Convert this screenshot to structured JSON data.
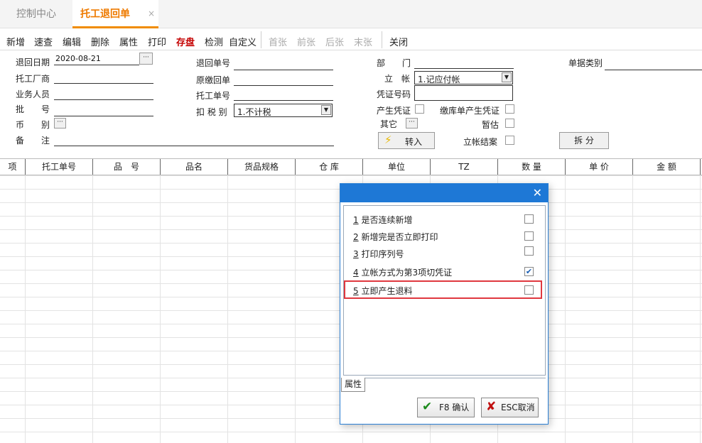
{
  "tabs": [
    {
      "label": "控制中心"
    },
    {
      "label": "托工退回单",
      "close": "×"
    }
  ],
  "toolbar": {
    "items": [
      "新增",
      "速查",
      "编辑",
      "删除",
      "属性",
      "打印",
      "存盘",
      "检测",
      "自定义"
    ],
    "nav": [
      "首张",
      "前张",
      "后张",
      "末张"
    ],
    "close": "关闭"
  },
  "form": {
    "return_date": {
      "label": "退回日期",
      "value": "2020-08-21",
      "button": "···"
    },
    "factory": {
      "label": "托工厂商"
    },
    "salesman": {
      "label": "业务人员"
    },
    "batch": {
      "label": "批　　号"
    },
    "currency": {
      "label": "币　　别",
      "button": "···"
    },
    "remark": {
      "label": "备　　注"
    },
    "return_no": {
      "label": "退回单号"
    },
    "orig_return": {
      "label": "原缴回单"
    },
    "consign_no": {
      "label": "托工单号"
    },
    "tax": {
      "label": "扣 税 别",
      "value": "1.不计税"
    },
    "dept": {
      "label": "部　　门"
    },
    "account": {
      "label": "立　帐",
      "value": "1.记应付帐"
    },
    "voucher_no": {
      "label": "凭证号码"
    },
    "gen_voucher": {
      "label": "产生凭证"
    },
    "stock_voucher": {
      "label": "缴库单产生凭证"
    },
    "other": {
      "label": "其它",
      "button": "···"
    },
    "temp_est": {
      "label": "暂估"
    },
    "transfer_btn": {
      "label": "转入"
    },
    "settle": {
      "label": "立帐结案"
    },
    "split_btn": {
      "label": "拆 分"
    },
    "doc_type": {
      "label": "单据类别"
    }
  },
  "grid": {
    "columns": [
      "项",
      "托工单号",
      "品　号",
      "品名",
      "货品规格",
      "仓 库",
      "单位",
      "TZ",
      "数 量",
      "单 价",
      "金 额"
    ]
  },
  "dialog": {
    "close": "✕",
    "options": [
      {
        "num": "1",
        "label": "是否连续新增",
        "checked": false
      },
      {
        "num": "2",
        "label": "新增完是否立即打印",
        "checked": false
      },
      {
        "num": "3",
        "label": "打印序列号",
        "checked": false
      },
      {
        "num": "4",
        "label": "立帐方式为第3项切凭证",
        "checked": true
      },
      {
        "num": "5",
        "label": "立即产生退料",
        "checked": false
      }
    ],
    "tab": "属性",
    "ok": "F8 确认",
    "cancel": "ESC取消",
    "highlight_color": "#e0383f"
  }
}
